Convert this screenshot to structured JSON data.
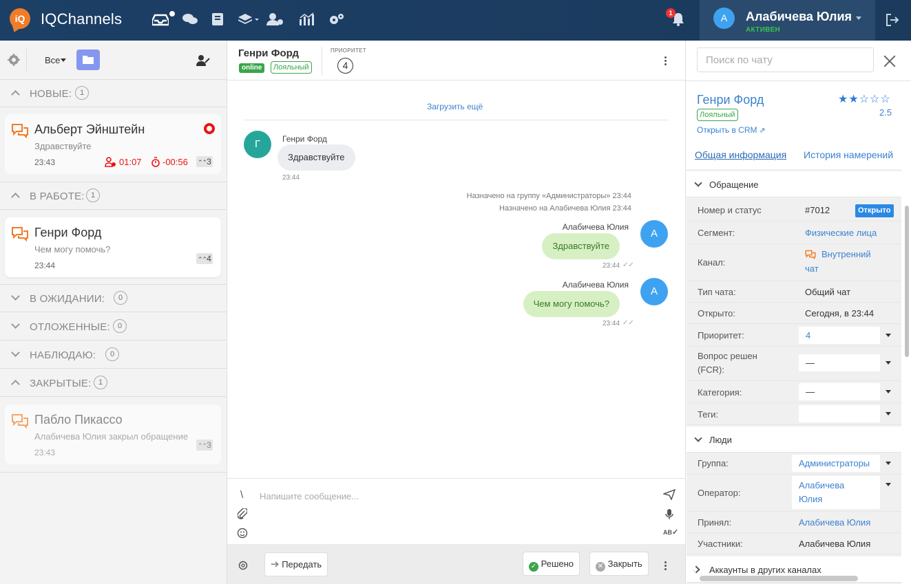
{
  "app": {
    "title": "IQChannels",
    "logo_text": "iQ",
    "notifications_count": "1"
  },
  "user": {
    "avatar_letter": "A",
    "name": "Алабичева Юлия",
    "status": "АКТИВЕН"
  },
  "left": {
    "filter_label": "Все",
    "sections": {
      "new": {
        "label": "НОВЫЕ:",
        "count": "1"
      },
      "in_work": {
        "label": "В РАБОТЕ:",
        "count": "1"
      },
      "waiting": {
        "label": "В ОЖИДАНИИ:",
        "count": "0"
      },
      "postponed": {
        "label": "ОТЛОЖЕННЫЕ:",
        "count": "0"
      },
      "watching": {
        "label": "НАБЛЮДАЮ:",
        "count": "0"
      },
      "closed": {
        "label": "ЗАКРЫТЫЕ:",
        "count": "1"
      }
    },
    "chats": [
      {
        "name": "Альберт Эйнштейн",
        "snippet": "Здравствуйте",
        "time": "23:43",
        "wait_timer": "01:07",
        "sla_timer": "-00:56",
        "priority": "3"
      },
      {
        "name": "Генри Форд",
        "snippet": "Чем могу помочь?",
        "time": "23:44",
        "priority": "4"
      },
      {
        "name": "Пабло Пикассо",
        "snippet": "Алабичева Юлия закрыл обращение",
        "time": "23:43",
        "priority": "3"
      }
    ]
  },
  "chat": {
    "contact_name": "Генри Форд",
    "online_badge": "online",
    "loyalty_badge": "Лояльный",
    "priority_label": "ПРИОРИТЕТ",
    "priority_value": "4",
    "load_more": "Загрузить ещё",
    "messages": [
      {
        "avatar": "Г",
        "author": "Генри Форд",
        "text": "Здравствуйте",
        "time": "23:44"
      },
      {
        "system": "Назначено на группу «Администраторы» 23:44"
      },
      {
        "system": "Назначено на Алабичева Юлия 23:44"
      },
      {
        "avatar": "A",
        "author": "Алабичева Юлия",
        "text": "Здравствуйте",
        "time": "23:44"
      },
      {
        "avatar": "A",
        "author": "Алабичева Юлия",
        "text": "Чем могу помочь?",
        "time": "23:44"
      }
    ],
    "composer_placeholder": "Напишите сообщение...",
    "composer_slash": "\\",
    "buttons": {
      "transfer": "Передать",
      "resolved": "Решено",
      "close": "Закрыть"
    }
  },
  "details": {
    "search_placeholder": "Поиск по чату",
    "client_name": "Генри Форд",
    "loyalty_badge": "Лояльный",
    "rating": "2.5",
    "rating_stars": "★★☆☆☆",
    "crm_link": "Открыть в CRM",
    "tabs": [
      "Общая информация",
      "История намерений"
    ],
    "appeal": {
      "title": "Обращение",
      "number_label": "Номер и статус",
      "number": "#7012",
      "status": "Открыто",
      "segment_label": "Сегмент:",
      "segment": "Физические лица",
      "channel_label": "Канал:",
      "channel_line1": "Внутренний",
      "channel_line2": "чат",
      "chat_type_label": "Тип чата:",
      "chat_type": "Общий чат",
      "opened_label": "Открыто:",
      "opened": "Сегодня, в 23:44",
      "priority_label": "Приоритет:",
      "priority": "4",
      "fcr_label_1": "Вопрос решен",
      "fcr_label_2": "(FCR):",
      "fcr": "—",
      "category_label": "Категория:",
      "category": "—",
      "tags_label": "Теги:",
      "tags": ""
    },
    "people": {
      "title": "Люди",
      "group_label": "Группа:",
      "group": "Администраторы",
      "operator_label": "Оператор:",
      "operator_line1": "Алабичева",
      "operator_line2": "Юлия",
      "accepted_label": "Принял:",
      "accepted": "Алабичева Юлия",
      "participants_label": "Участники:",
      "participants": "Алабичева Юлия"
    },
    "accounts": {
      "title": "Аккаунты в других каналах"
    }
  },
  "colors": {
    "topbar": "#1c3f66",
    "accent_orange": "#f07c2a",
    "link_blue": "#3b82d0",
    "online_green": "#3aa54b",
    "alert_red": "#e11111",
    "outgoing_bubble": "#d6f0c4"
  }
}
